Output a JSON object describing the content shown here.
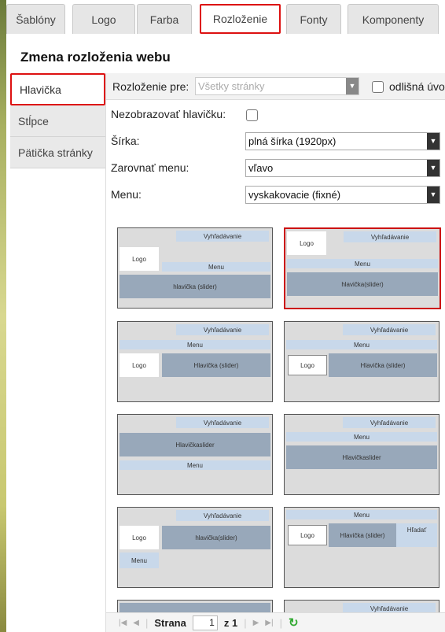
{
  "tabs": [
    {
      "label": "Šablóny"
    },
    {
      "label": "Logo"
    },
    {
      "label": "Farba"
    },
    {
      "label": "Rozloženie"
    },
    {
      "label": "Fonty"
    },
    {
      "label": "Komponenty"
    }
  ],
  "heading": "Zmena rozloženia webu",
  "sidebar": [
    {
      "label": "Hlavička"
    },
    {
      "label": "Stĺpce"
    },
    {
      "label": "Pätička stránky"
    }
  ],
  "form": {
    "layout_for_label": "Rozloženie pre:",
    "layout_for_value": "Všetky stránky",
    "different_label": "odlišná úvo",
    "hide_header_label": "Nezobrazovať hlavičku:",
    "width_label": "Šírka:",
    "width_value": "plná šírka (1920px)",
    "align_label": "Zarovnať menu:",
    "align_value": "vľavo",
    "menu_label": "Menu:",
    "menu_value": "vyskakovacie (fixné)"
  },
  "thumbs": {
    "search": "Vyhľadávanie",
    "logo": "Logo",
    "menu": "Menu",
    "header_slider": "hlavička (slider)",
    "header_slider2": "hlavička(slider)",
    "header_slider_cap": "Hlavička (slider)",
    "header_slider_nospace": "Hlavičkaslider",
    "search_short": "Hľadať"
  },
  "pager": {
    "page_label": "Strana",
    "page_value": "1",
    "of_label": "z 1"
  }
}
